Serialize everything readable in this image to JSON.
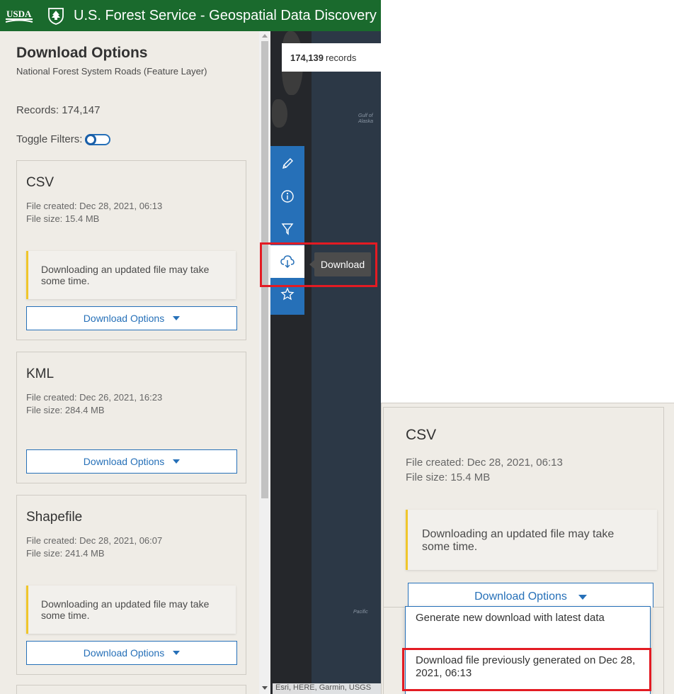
{
  "header": {
    "usda_logo_text": "USDA",
    "title": "U.S. Forest Service - Geospatial Data Discovery"
  },
  "panel": {
    "title": "Download Options",
    "subtitle": "National Forest System Roads (Feature Layer)",
    "records": "Records: 174,147",
    "toggle_label": "Toggle Filters:",
    "toggle_state": "off",
    "cards": [
      {
        "title": "CSV",
        "created": "File created: Dec 28, 2021, 06:13",
        "size": "File size: 15.4 MB",
        "notice": "Downloading an updated file may take some time.",
        "button": "Download Options"
      },
      {
        "title": "KML",
        "created": "File created: Dec 26, 2021, 16:23",
        "size": "File size: 284.4 MB",
        "button": "Download Options"
      },
      {
        "title": "Shapefile",
        "created": "File created: Dec 28, 2021, 06:07",
        "size": "File size: 241.4 MB",
        "notice": "Downloading an updated file may take some time.",
        "button": "Download Options"
      }
    ]
  },
  "map": {
    "records_count": "174,139",
    "records_word": "records",
    "label_gulf": "Gulf of\nAlaska",
    "label_pacific": "Pacific",
    "attribution": "Esri, HERE, Garmin, USGS"
  },
  "toolbar": {
    "tools": [
      "pencil-icon",
      "info-icon",
      "filter-icon",
      "cloud-download-icon",
      "star-icon"
    ],
    "active": "cloud-download-icon",
    "tooltip": "Download"
  },
  "inset": {
    "title": "CSV",
    "created": "File created: Dec 28, 2021, 06:13",
    "size": "File size: 15.4 MB",
    "notice": "Downloading an updated file may take some time.",
    "button": "Download Options",
    "dropdown": [
      "Generate new download with latest data",
      "Download file previously generated on Dec 28, 2021, 06:13"
    ]
  },
  "colors": {
    "header_green": "#1a6a2d",
    "accent_blue": "#2670b8",
    "highlight_red": "#e31b23",
    "notice_yellow": "#f0c62b",
    "panel_bg": "#efece6"
  }
}
